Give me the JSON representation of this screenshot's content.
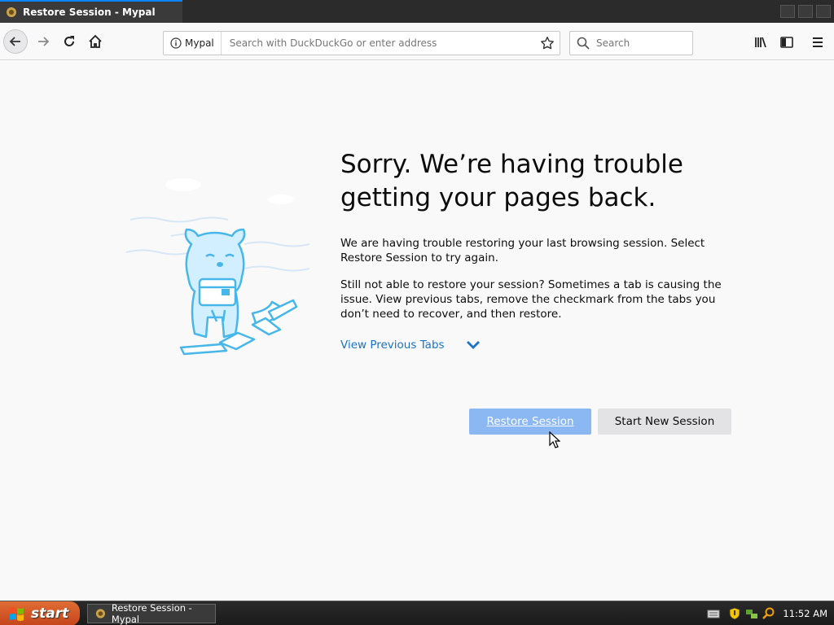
{
  "window": {
    "tab_title": "Restore Session - Mypal"
  },
  "toolbar": {
    "identity_label": "Mypal",
    "url_placeholder": "Search with DuckDuckGo or enter address",
    "search_placeholder": "Search"
  },
  "content": {
    "title": "Sorry. We’re having trouble getting your pages back.",
    "paragraph1": "We are having trouble restoring your last browsing session. Select Restore Session to try again.",
    "paragraph2": "Still not able to restore your session? Sometimes a tab is causing the issue. View previous tabs, remove the checkmark from the tabs you don’t need to recover, and then restore.",
    "view_previous_tabs": "View Previous Tabs",
    "restore_button": "Restore Session",
    "new_session_button": "Start New Session"
  },
  "taskbar": {
    "start_label": "start",
    "task_label": "Restore Session - Mypal",
    "clock": "11:52 AM"
  },
  "colors": {
    "accent": "#0a84ff",
    "restore_button_bg": "#8bb8f2",
    "link": "#1a73c9"
  }
}
